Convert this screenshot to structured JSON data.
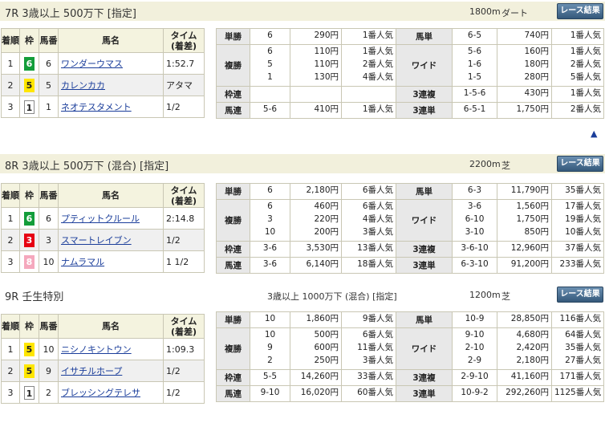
{
  "headers": {
    "chakujun": "着順",
    "waku": "枠",
    "umaban": "馬番",
    "bamei": "馬名",
    "time": "タイム",
    "time_sub": "(着差)"
  },
  "button_label": "レース結果",
  "up_icon": "▲",
  "races": [
    {
      "title": "7R 3歳以上 500万下 [指定]",
      "condition": "",
      "distance": "1800m",
      "surface": "ダート",
      "results": [
        {
          "pos": "1",
          "waku": "6",
          "waku_color": "#139d3a",
          "num": "6",
          "name": "ワンダーウマス",
          "time": "1:52.7"
        },
        {
          "pos": "2",
          "waku": "5",
          "waku_color": "#ffe600",
          "num": "5",
          "name": "カレンカカ",
          "time": "アタマ"
        },
        {
          "pos": "3",
          "waku": "1",
          "waku_color": "#ffffff",
          "num": "1",
          "name": "ネオテスタメント",
          "time": "1/2"
        }
      ],
      "payouts": {
        "tansho": {
          "label": "単勝",
          "nums": [
            "6"
          ],
          "amounts": [
            "290円"
          ],
          "pops": [
            "1番人気"
          ]
        },
        "fukusho": {
          "label": "複勝",
          "nums": [
            "6",
            "5",
            "1"
          ],
          "amounts": [
            "110円",
            "110円",
            "130円"
          ],
          "pops": [
            "1番人気",
            "2番人気",
            "4番人気"
          ]
        },
        "wakuren": {
          "label": "枠連",
          "nums": [],
          "amounts": [],
          "pops": []
        },
        "umaren": {
          "label": "馬連",
          "nums": [
            "5-6"
          ],
          "amounts": [
            "410円"
          ],
          "pops": [
            "1番人気"
          ]
        },
        "umatan": {
          "label": "馬単",
          "nums": [
            "6-5"
          ],
          "amounts": [
            "740円"
          ],
          "pops": [
            "1番人気"
          ]
        },
        "wide": {
          "label": "ワイド",
          "nums": [
            "5-6",
            "1-6",
            "1-5"
          ],
          "amounts": [
            "160円",
            "180円",
            "280円"
          ],
          "pops": [
            "1番人気",
            "2番人気",
            "5番人気"
          ]
        },
        "sanrenpuku": {
          "label": "3連複",
          "nums": [
            "1-5-6"
          ],
          "amounts": [
            "430円"
          ],
          "pops": [
            "1番人気"
          ]
        },
        "sanrentan": {
          "label": "3連単",
          "nums": [
            "6-5-1"
          ],
          "amounts": [
            "1,750円"
          ],
          "pops": [
            "2番人気"
          ]
        }
      }
    },
    {
      "title": "8R 3歳以上 500万下 (混合) [指定]",
      "condition": "",
      "distance": "2200m",
      "surface": "芝",
      "results": [
        {
          "pos": "1",
          "waku": "6",
          "waku_color": "#139d3a",
          "num": "6",
          "name": "プティットクルール",
          "time": "2:14.8"
        },
        {
          "pos": "2",
          "waku": "3",
          "waku_color": "#e60012",
          "num": "3",
          "name": "スマートレイブン",
          "time": "1/2"
        },
        {
          "pos": "3",
          "waku": "8",
          "waku_color": "#f5a8bd",
          "num": "10",
          "name": "ナムラマル",
          "time": "1 1/2"
        }
      ],
      "payouts": {
        "tansho": {
          "label": "単勝",
          "nums": [
            "6"
          ],
          "amounts": [
            "2,180円"
          ],
          "pops": [
            "6番人気"
          ]
        },
        "fukusho": {
          "label": "複勝",
          "nums": [
            "6",
            "3",
            "10"
          ],
          "amounts": [
            "460円",
            "220円",
            "200円"
          ],
          "pops": [
            "6番人気",
            "4番人気",
            "3番人気"
          ]
        },
        "wakuren": {
          "label": "枠連",
          "nums": [
            "3-6"
          ],
          "amounts": [
            "3,530円"
          ],
          "pops": [
            "13番人気"
          ]
        },
        "umaren": {
          "label": "馬連",
          "nums": [
            "3-6"
          ],
          "amounts": [
            "6,140円"
          ],
          "pops": [
            "18番人気"
          ]
        },
        "umatan": {
          "label": "馬単",
          "nums": [
            "6-3"
          ],
          "amounts": [
            "11,790円"
          ],
          "pops": [
            "35番人気"
          ]
        },
        "wide": {
          "label": "ワイド",
          "nums": [
            "3-6",
            "6-10",
            "3-10"
          ],
          "amounts": [
            "1,560円",
            "1,750円",
            "850円"
          ],
          "pops": [
            "17番人気",
            "19番人気",
            "10番人気"
          ]
        },
        "sanrenpuku": {
          "label": "3連複",
          "nums": [
            "3-6-10"
          ],
          "amounts": [
            "12,960円"
          ],
          "pops": [
            "37番人気"
          ]
        },
        "sanrentan": {
          "label": "3連単",
          "nums": [
            "6-3-10"
          ],
          "amounts": [
            "91,200円"
          ],
          "pops": [
            "233番人気"
          ]
        }
      }
    },
    {
      "title": "9R 壬生特別",
      "condition": "3歳以上 1000万下 (混合) [指定]",
      "distance": "1200m",
      "surface": "芝",
      "results": [
        {
          "pos": "1",
          "waku": "5",
          "waku_color": "#ffe600",
          "num": "10",
          "name": "ニシノキントウン",
          "time": "1:09.3"
        },
        {
          "pos": "2",
          "waku": "5",
          "waku_color": "#ffe600",
          "num": "9",
          "name": "イサチルホープ",
          "time": "1/2"
        },
        {
          "pos": "3",
          "waku": "1",
          "waku_color": "#ffffff",
          "num": "2",
          "name": "ブレッシングテレサ",
          "time": "1/2"
        }
      ],
      "payouts": {
        "tansho": {
          "label": "単勝",
          "nums": [
            "10"
          ],
          "amounts": [
            "1,860円"
          ],
          "pops": [
            "9番人気"
          ]
        },
        "fukusho": {
          "label": "複勝",
          "nums": [
            "10",
            "9",
            "2"
          ],
          "amounts": [
            "500円",
            "600円",
            "250円"
          ],
          "pops": [
            "6番人気",
            "11番人気",
            "3番人気"
          ]
        },
        "wakuren": {
          "label": "枠連",
          "nums": [
            "5-5"
          ],
          "amounts": [
            "14,260円"
          ],
          "pops": [
            "33番人気"
          ]
        },
        "umaren": {
          "label": "馬連",
          "nums": [
            "9-10"
          ],
          "amounts": [
            "16,020円"
          ],
          "pops": [
            "60番人気"
          ]
        },
        "umatan": {
          "label": "馬単",
          "nums": [
            "10-9"
          ],
          "amounts": [
            "28,850円"
          ],
          "pops": [
            "116番人気"
          ]
        },
        "wide": {
          "label": "ワイド",
          "nums": [
            "9-10",
            "2-10",
            "2-9"
          ],
          "amounts": [
            "4,680円",
            "2,420円",
            "2,180円"
          ],
          "pops": [
            "64番人気",
            "35番人気",
            "27番人気"
          ]
        },
        "sanrenpuku": {
          "label": "3連複",
          "nums": [
            "2-9-10"
          ],
          "amounts": [
            "41,160円"
          ],
          "pops": [
            "171番人気"
          ]
        },
        "sanrentan": {
          "label": "3連単",
          "nums": [
            "10-9-2"
          ],
          "amounts": [
            "292,260円"
          ],
          "pops": [
            "1125番人気"
          ]
        }
      }
    }
  ]
}
